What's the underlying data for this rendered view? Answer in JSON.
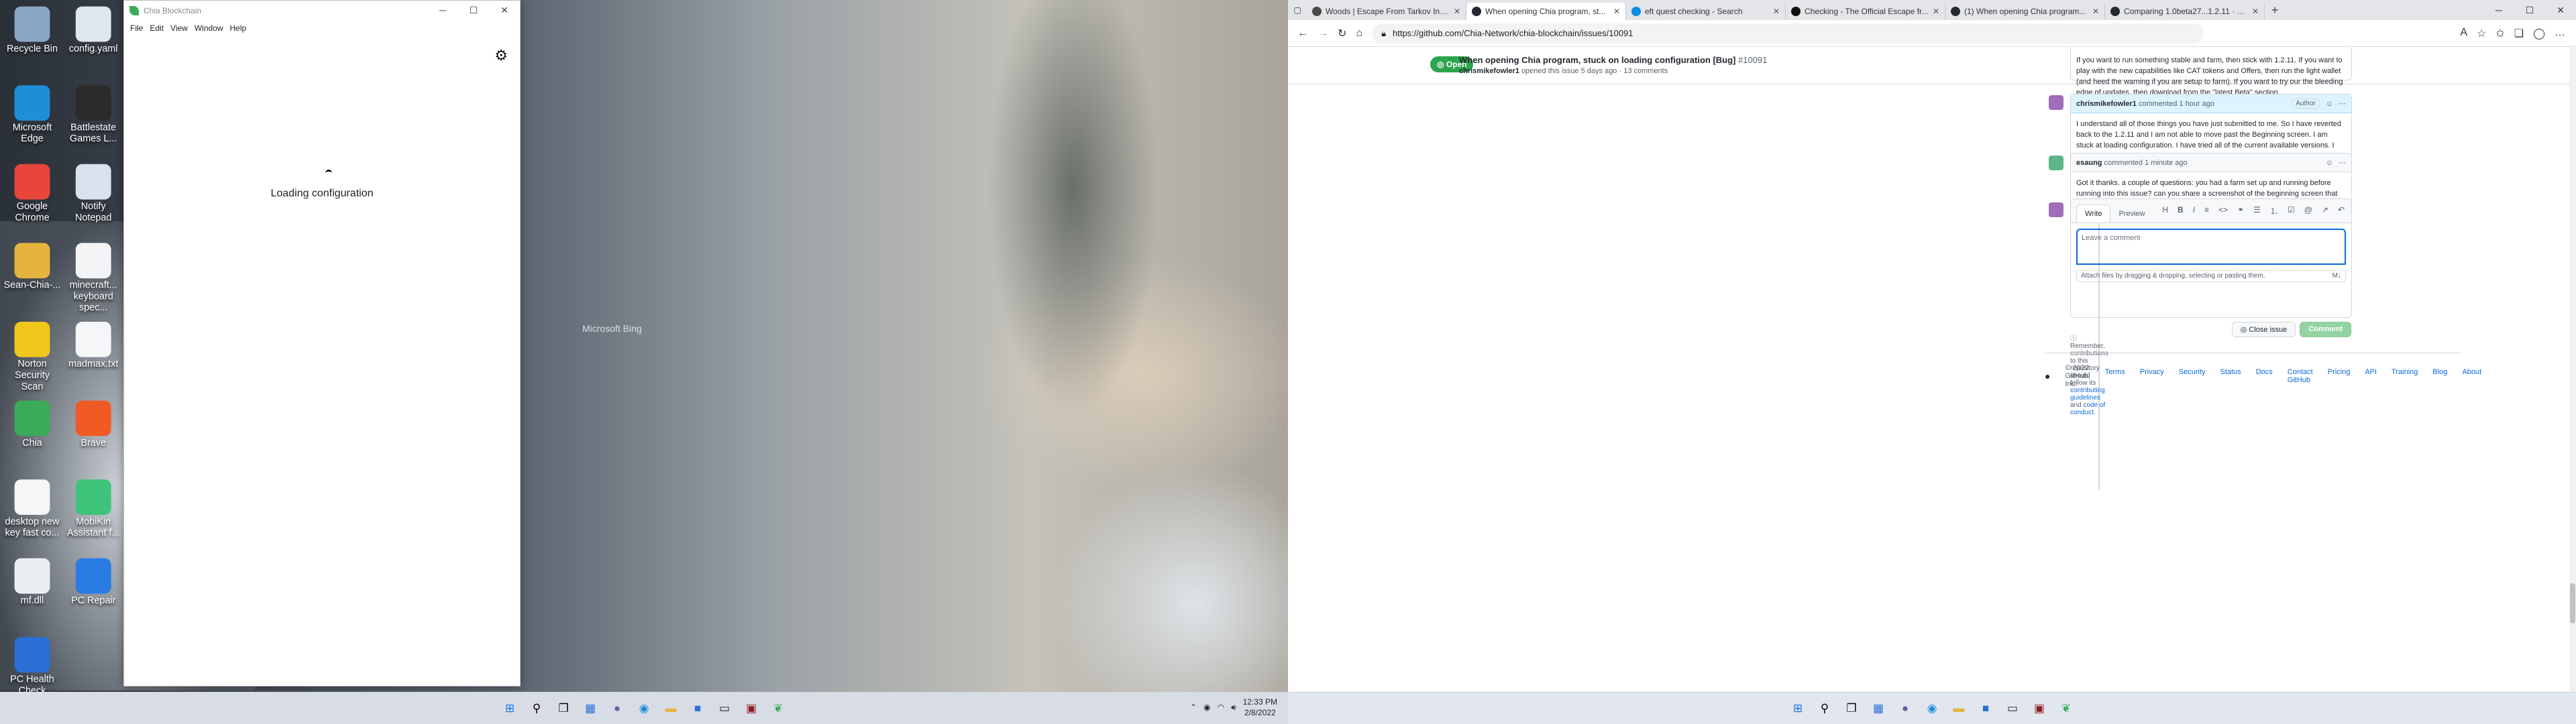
{
  "desktop": {
    "icons": [
      {
        "label": "Recycle Bin",
        "color": "#8aa7c4"
      },
      {
        "label": "config.yaml",
        "color": "#dfe6ee"
      },
      {
        "label": "Microsoft Edge",
        "color": "#1f8ed8"
      },
      {
        "label": "Battlestate Games L...",
        "color": "#2b2b2b"
      },
      {
        "label": "Google Chrome",
        "color": "#e8453c"
      },
      {
        "label": "Notify Notepad",
        "color": "#d8e2ec"
      },
      {
        "label": "Sean-Chia-...",
        "color": "#e4b43e"
      },
      {
        "label": "minecraft... keyboard spec...",
        "color": "#f2f4f6"
      },
      {
        "label": "Norton Security Scan",
        "color": "#f0c81c"
      },
      {
        "label": "madmax.txt",
        "color": "#f4f6f8"
      },
      {
        "label": "Chia",
        "color": "#3aac59"
      },
      {
        "label": "Brave",
        "color": "#f15a24"
      },
      {
        "label": "desktop new key fast co...",
        "color": "#f4f6f8"
      },
      {
        "label": "MobiKin Assistant f...",
        "color": "#3ec47a"
      },
      {
        "label": "mf.dll",
        "color": "#eceff2"
      },
      {
        "label": "PC Repair",
        "color": "#2b7be4"
      },
      {
        "label": "PC Health Check",
        "color": "#2a6fd6"
      }
    ],
    "watermark": "Microsoft Bing",
    "clock_time": "12:33 PM",
    "clock_date": "2/8/2022"
  },
  "chia": {
    "title": "Chia Blockchain",
    "menu": [
      "File",
      "Edit",
      "View",
      "Window",
      "Help"
    ],
    "loading_text": "Loading configuration"
  },
  "browser": {
    "tabs": [
      {
        "title": "Woods | Escape From Tarkov Inte...",
        "fav": "#4a4a4a",
        "active": false
      },
      {
        "title": "When opening Chia program, st...",
        "fav": "#24292f",
        "active": true
      },
      {
        "title": "eft quest checking - Search",
        "fav": "#0c8ce9",
        "active": false
      },
      {
        "title": "Checking - The Official Escape fr...",
        "fav": "#111111",
        "active": false
      },
      {
        "title": "(1) When opening Chia program...",
        "fav": "#24292f",
        "active": false
      },
      {
        "title": "Comparing 1.0beta27...1.2.11 · C...",
        "fav": "#24292f",
        "active": false
      }
    ],
    "url": "https://github.com/Chia-Network/chia-blockchain/issues/10091"
  },
  "issue": {
    "state": "Open",
    "title": "When opening Chia program, stuck on loading configuration [Bug]",
    "number": "#10091",
    "author": "chrismikefowler1",
    "meta_rest": "opened this issue 5 days ago · 13 comments"
  },
  "comments": [
    {
      "author": "",
      "when": "",
      "badge": "",
      "body": "If you want to run something stable and farm, then stick with 1.2.11. If you want to play with the new capabilities like CAT tokens and Offers, then run the light wallet (and heed the warning if you are setup to farm). If you want to try our the bleeding edge of updates, then download from the \"latest Beta\" section."
    },
    {
      "author": "chrismikefowler1",
      "when": "commented 1 hour ago",
      "badge": "Author",
      "body": "I understand all of those things you have just submitted to me. So I have reverted back to the 1.2.11 and I am not able to move past the Beginning screen. I am stuck at loading configuration. I have tried all of the current available versions. I am not able to farm."
    },
    {
      "author": "esaung",
      "when": "commented 1 minute ago",
      "badge": "",
      "body": "Got it thanks. a couple of questions: you had a farm set up and running before running into this issue? can you share a screenshot of the beginning screen that you are stuck on?"
    }
  ],
  "editor": {
    "write_tab": "Write",
    "preview_tab": "Preview",
    "placeholder": "Leave a comment",
    "attach_hint": "Attach files by dragging & dropping, selecting or pasting them.",
    "close_btn": "Close issue",
    "comment_btn": "Comment",
    "tip_prefix": "Remember, contributions to this repository should follow its",
    "tip_link1": "contributing guidelines",
    "tip_and": "and",
    "tip_link2": "code of conduct"
  },
  "footer": {
    "copyright": "© 2022 GitHub, Inc.",
    "links": [
      "Terms",
      "Privacy",
      "Security",
      "Status",
      "Docs",
      "Contact GitHub",
      "Pricing",
      "API",
      "Training",
      "Blog",
      "About"
    ]
  }
}
